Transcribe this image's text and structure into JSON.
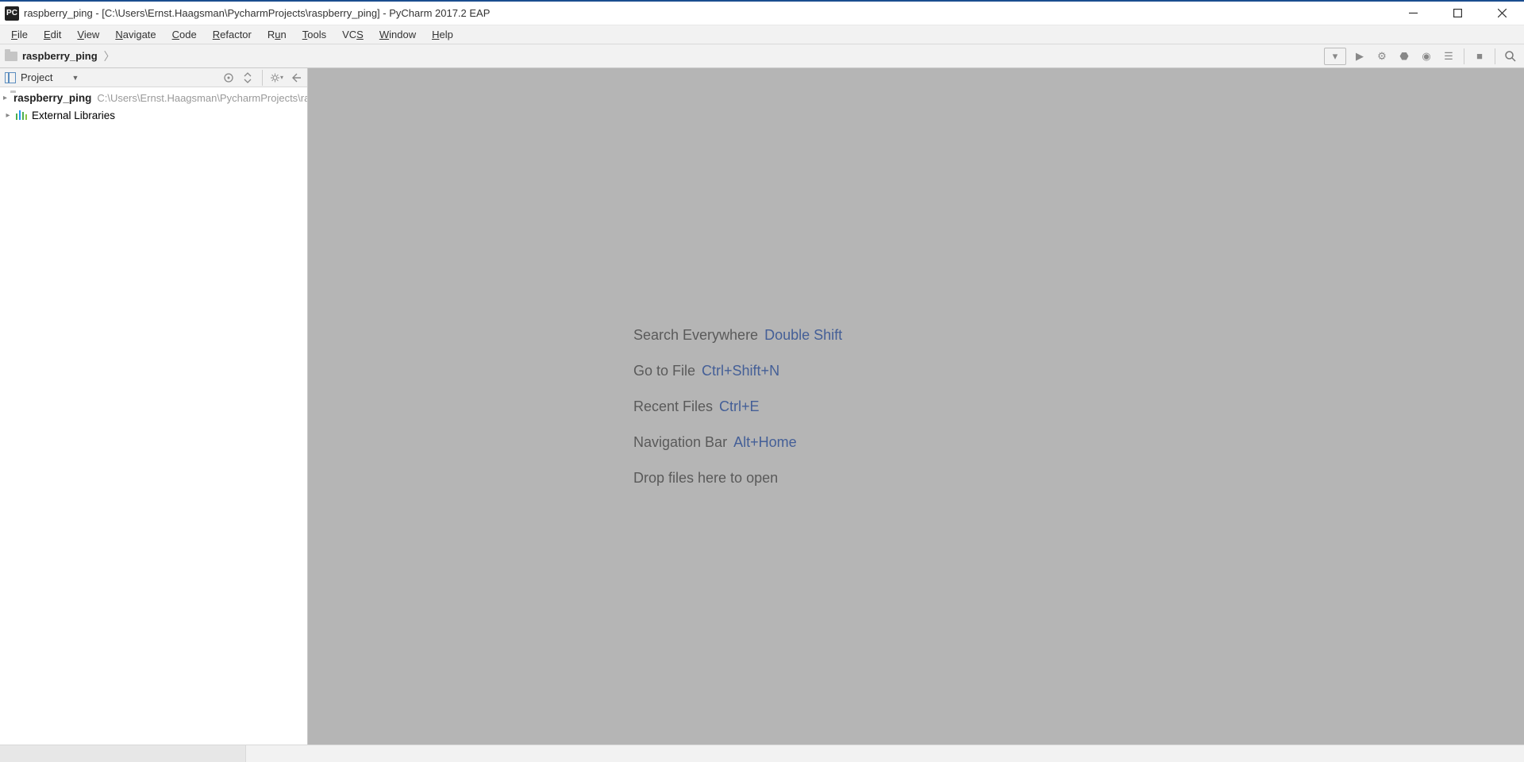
{
  "titlebar": {
    "app_icon_text": "PC",
    "title": "raspberry_ping - [C:\\Users\\Ernst.Haagsman\\PycharmProjects\\raspberry_ping] - PyCharm 2017.2 EAP"
  },
  "menubar": {
    "items": [
      {
        "label": "File",
        "accel": "F"
      },
      {
        "label": "Edit",
        "accel": "E"
      },
      {
        "label": "View",
        "accel": "V"
      },
      {
        "label": "Navigate",
        "accel": "N"
      },
      {
        "label": "Code",
        "accel": "C"
      },
      {
        "label": "Refactor",
        "accel": "R"
      },
      {
        "label": "Run",
        "accel": "u"
      },
      {
        "label": "Tools",
        "accel": "T"
      },
      {
        "label": "VCS",
        "accel": "S"
      },
      {
        "label": "Window",
        "accel": "W"
      },
      {
        "label": "Help",
        "accel": "H"
      }
    ]
  },
  "breadcrumb": {
    "project": "raspberry_ping"
  },
  "project_panel": {
    "title": "Project",
    "tree": {
      "root_name": "raspberry_ping",
      "root_path": "C:\\Users\\Ernst.Haagsman\\PycharmProjects\\raspberry_ping",
      "external_libs": "External Libraries"
    }
  },
  "editor_hints": [
    {
      "label": "Search Everywhere",
      "key": "Double Shift"
    },
    {
      "label": "Go to File",
      "key": "Ctrl+Shift+N"
    },
    {
      "label": "Recent Files",
      "key": "Ctrl+E"
    },
    {
      "label": "Navigation Bar",
      "key": "Alt+Home"
    },
    {
      "label": "Drop files here to open",
      "key": ""
    }
  ],
  "toolbar_icons": {
    "run_config_dropdown": "▾",
    "run": "▶",
    "debug": "⚙",
    "coverage": "⬣",
    "profile": "◉",
    "structure": "☰",
    "stop": "■",
    "search": "🔍"
  }
}
